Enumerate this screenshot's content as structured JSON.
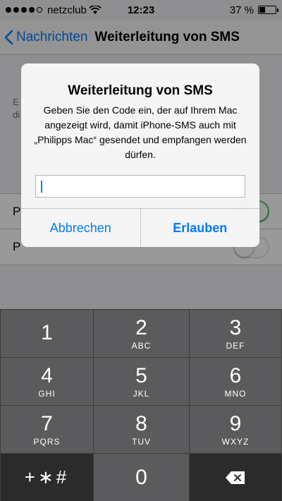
{
  "status_bar": {
    "carrier": "netzclub",
    "time": "12:23",
    "battery_percent": "37 %",
    "battery_level": 0.37,
    "signal_bars_filled": 4
  },
  "nav": {
    "back_label": "Nachrichten",
    "title": "Weiterleitung von SMS"
  },
  "background": {
    "footer_text_visible": [
      "E",
      "di"
    ],
    "rows": [
      {
        "label": "P",
        "toggle_on": true
      },
      {
        "label": "P",
        "toggle_on": false
      }
    ]
  },
  "alert": {
    "title": "Weiterleitung von SMS",
    "message": "Geben Sie den Code ein, der auf Ihrem Mac angezeigt wird, damit iPhone-SMS auch mit „Philipps Mac“ gesendet und empfangen werden dürfen.",
    "input_value": "",
    "cancel_label": "Abbrechen",
    "allow_label": "Erlauben"
  },
  "keypad": {
    "keys": [
      {
        "num": "1",
        "letters": ""
      },
      {
        "num": "2",
        "letters": "ABC"
      },
      {
        "num": "3",
        "letters": "DEF"
      },
      {
        "num": "4",
        "letters": "GHI"
      },
      {
        "num": "5",
        "letters": "JKL"
      },
      {
        "num": "6",
        "letters": "MNO"
      },
      {
        "num": "7",
        "letters": "PQRS"
      },
      {
        "num": "8",
        "letters": "TUV"
      },
      {
        "num": "9",
        "letters": "WXYZ"
      }
    ],
    "symbols_label": "+∗#",
    "zero": "0"
  },
  "colors": {
    "accent": "#007aff",
    "toggle_on": "#4cd964"
  }
}
